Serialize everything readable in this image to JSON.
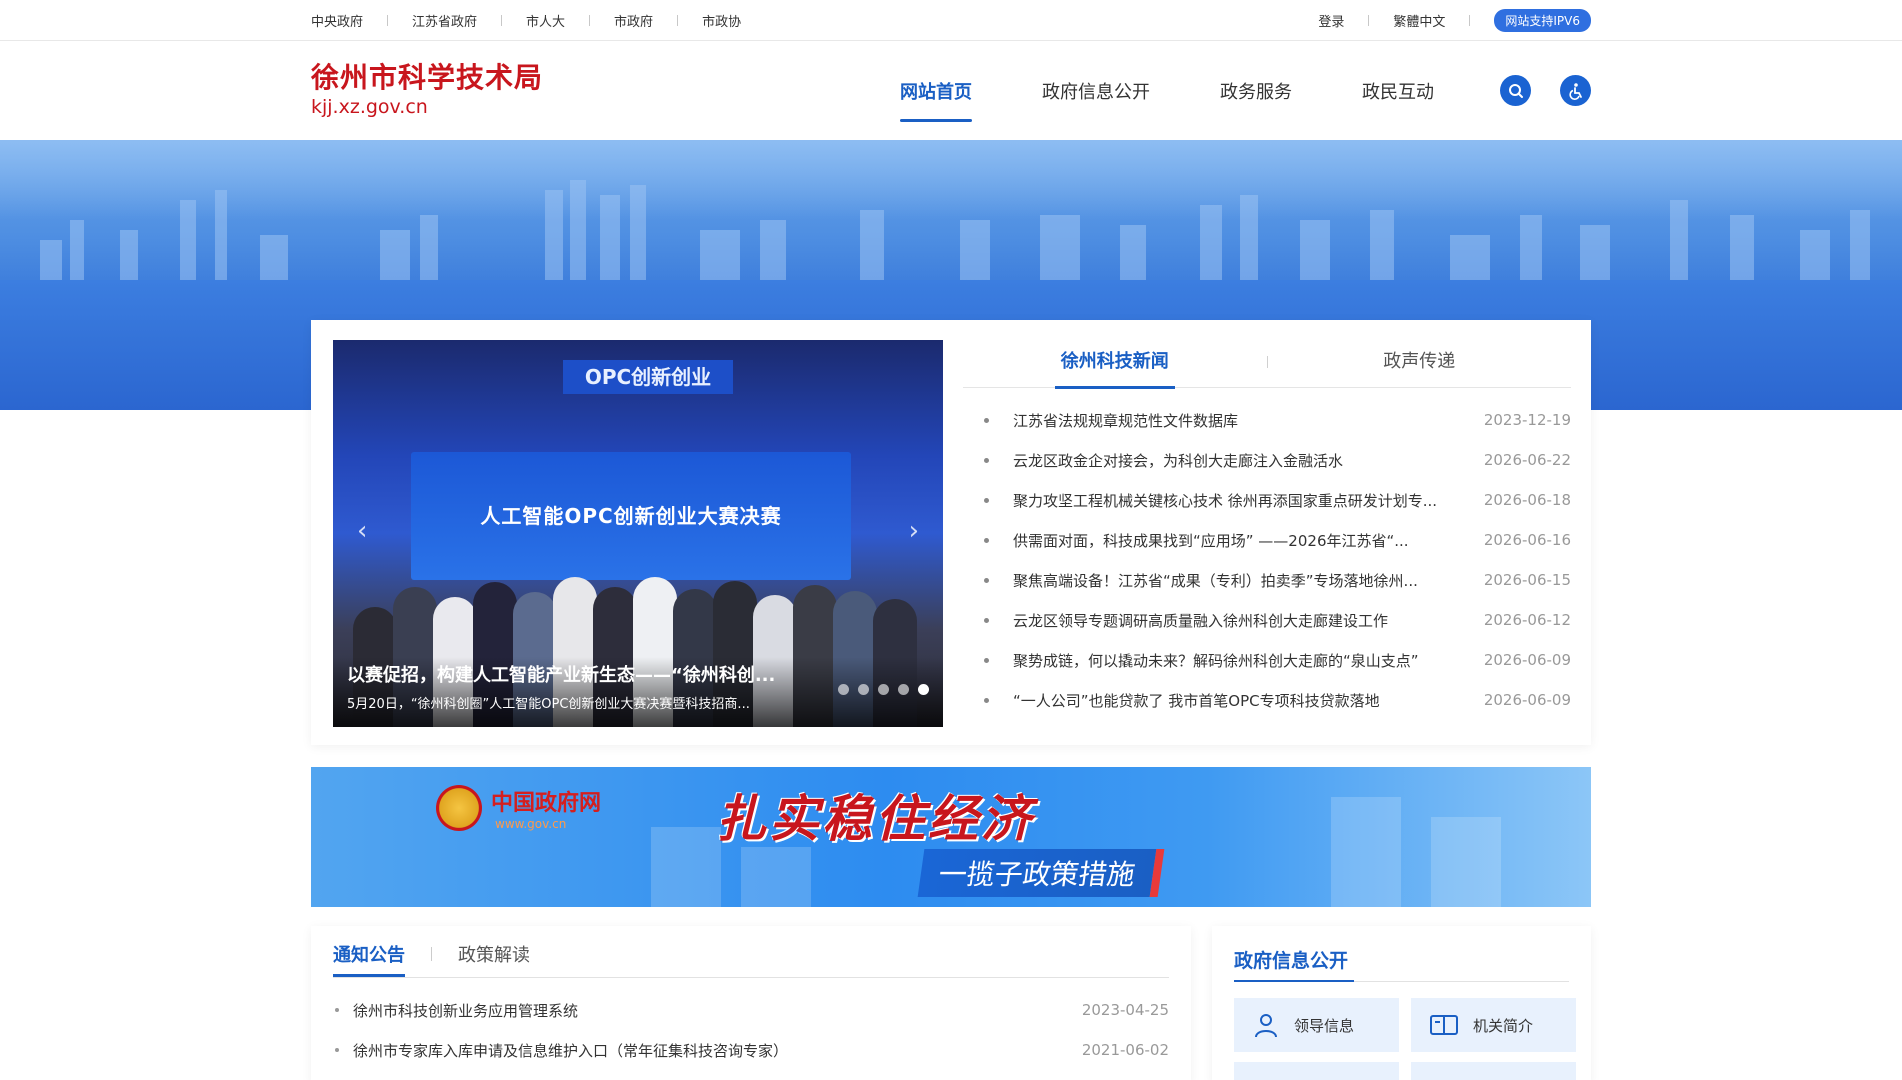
{
  "topbar": {
    "links": [
      "中央政府",
      "江苏省政府",
      "市人大",
      "市政府",
      "市政协"
    ],
    "login": "登录",
    "traditional": "繁體中文",
    "ipv6": "网站支持IPV6"
  },
  "header": {
    "title": "徐州市科学技术局",
    "url": "kjj.xz.gov.cn",
    "nav": [
      "网站首页",
      "政府信息公开",
      "政务服务",
      "政民互动"
    ],
    "active_nav": 0
  },
  "carousel": {
    "caption_title": "以赛促招，构建人工智能产业新生态——“徐州科创...",
    "caption_sub": "5月20日，“徐州科创圈”人工智能OPC创新创业大赛决赛暨科技招商...",
    "screen_title": "人工智能OPC创新创业大赛决赛",
    "top_sign": "OPC创新创业",
    "slide_count": 5,
    "active_slide": 4
  },
  "news": {
    "tabs": [
      "徐州科技新闻",
      "政声传递"
    ],
    "active_tab": 0,
    "items": [
      {
        "title": "江苏省法规规章规范性文件数据库",
        "date": "2023-12-19"
      },
      {
        "title": "云龙区政金企对接会，为科创大走廊注入金融活水",
        "date": "2026-06-22"
      },
      {
        "title": "聚力攻坚工程机械关键核心技术 徐州再添国家重点研发计划专...",
        "date": "2026-06-18"
      },
      {
        "title": "供需面对面，科技成果找到“应用场” ——2026年江苏省“...",
        "date": "2026-06-16"
      },
      {
        "title": "聚焦高端设备！江苏省“成果（专利）拍卖季”专场落地徐州...",
        "date": "2026-06-15"
      },
      {
        "title": "云龙区领导专题调研高质量融入徐州科创大走廊建设工作",
        "date": "2026-06-12"
      },
      {
        "title": "聚势成链，何以撬动未来？解码徐州科创大走廊的“泉山支点”",
        "date": "2026-06-09"
      },
      {
        "title": "“一人公司”也能贷款了 我市首笔OPC专项科技贷款落地",
        "date": "2026-06-09"
      }
    ]
  },
  "promo": {
    "site_name": "中国政府网",
    "site_url": "www.gov.cn",
    "slogan": "扎实稳住经济",
    "sub": "一揽子政策措施"
  },
  "notice": {
    "tabs": [
      "通知公告",
      "政策解读"
    ],
    "active_tab": 0,
    "items": [
      {
        "title": "徐州市科技创新业务应用管理系统",
        "date": "2023-04-25"
      },
      {
        "title": "徐州市专家库入库申请及信息维护入口（常年征集科技咨询专家）",
        "date": "2021-06-02"
      }
    ]
  },
  "govinfo": {
    "title": "政府信息公开",
    "buttons": [
      "领导信息",
      "机关简介"
    ]
  },
  "colors": {
    "primary": "#1a5fc4",
    "brand_red": "#c8161d",
    "ipv6_badge": "#2f6fe0"
  }
}
